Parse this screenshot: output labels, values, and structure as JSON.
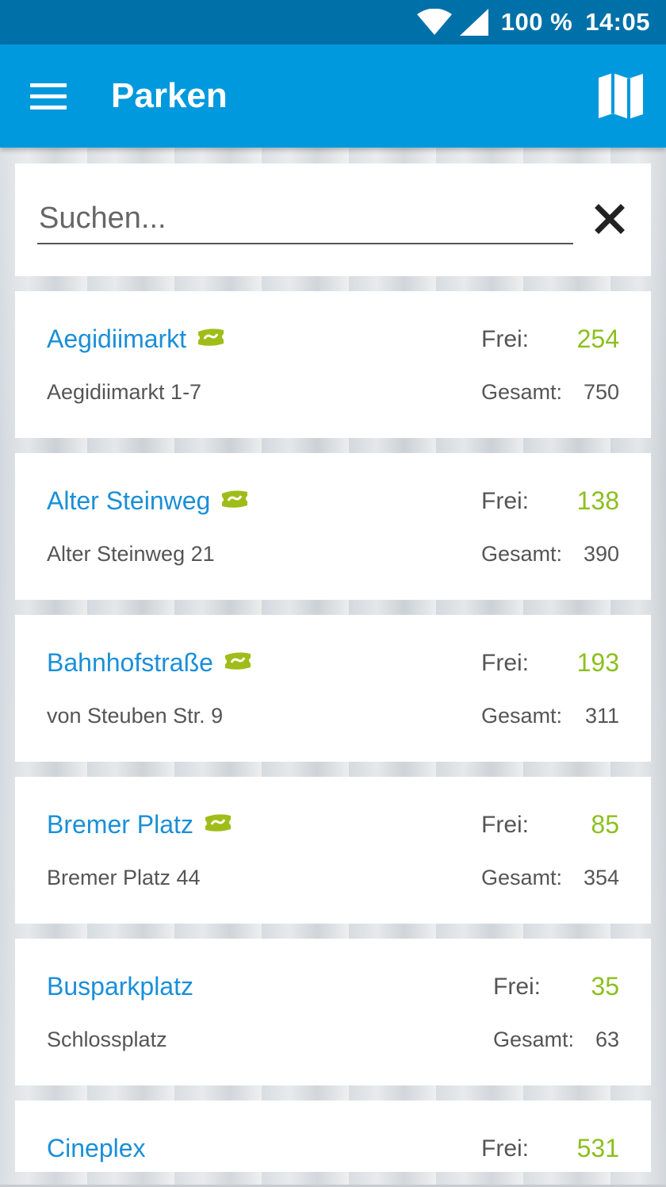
{
  "status": {
    "battery": "100 %",
    "time": "14:05"
  },
  "appbar": {
    "title": "Parken"
  },
  "search": {
    "placeholder": "Suchen..."
  },
  "labels": {
    "free": "Frei:",
    "total": "Gesamt:"
  },
  "colors": {
    "statusbar": "#0070a8",
    "appbar": "#0099dd",
    "name": "#1a8fd8",
    "free_value": "#8cbf1e"
  },
  "icons": {
    "menu": "menu-icon",
    "map": "map-icon",
    "clear": "close-icon",
    "ticket": "ticket-icon"
  },
  "parking": [
    {
      "name": "Aegidiimarkt",
      "address": "Aegidiimarkt 1-7",
      "free": "254",
      "total": "750",
      "ticket": true
    },
    {
      "name": "Alter Steinweg",
      "address": "Alter Steinweg 21",
      "free": "138",
      "total": "390",
      "ticket": true
    },
    {
      "name": "Bahnhofstraße",
      "address": "von Steuben Str. 9",
      "free": "193",
      "total": "311",
      "ticket": true
    },
    {
      "name": "Bremer Platz",
      "address": "Bremer Platz 44",
      "free": "85",
      "total": "354",
      "ticket": true
    },
    {
      "name": "Busparkplatz",
      "address": "Schlossplatz",
      "free": "35",
      "total": "63",
      "ticket": false
    },
    {
      "name": "Cineplex",
      "address": "",
      "free": "531",
      "total": "",
      "ticket": false
    }
  ]
}
